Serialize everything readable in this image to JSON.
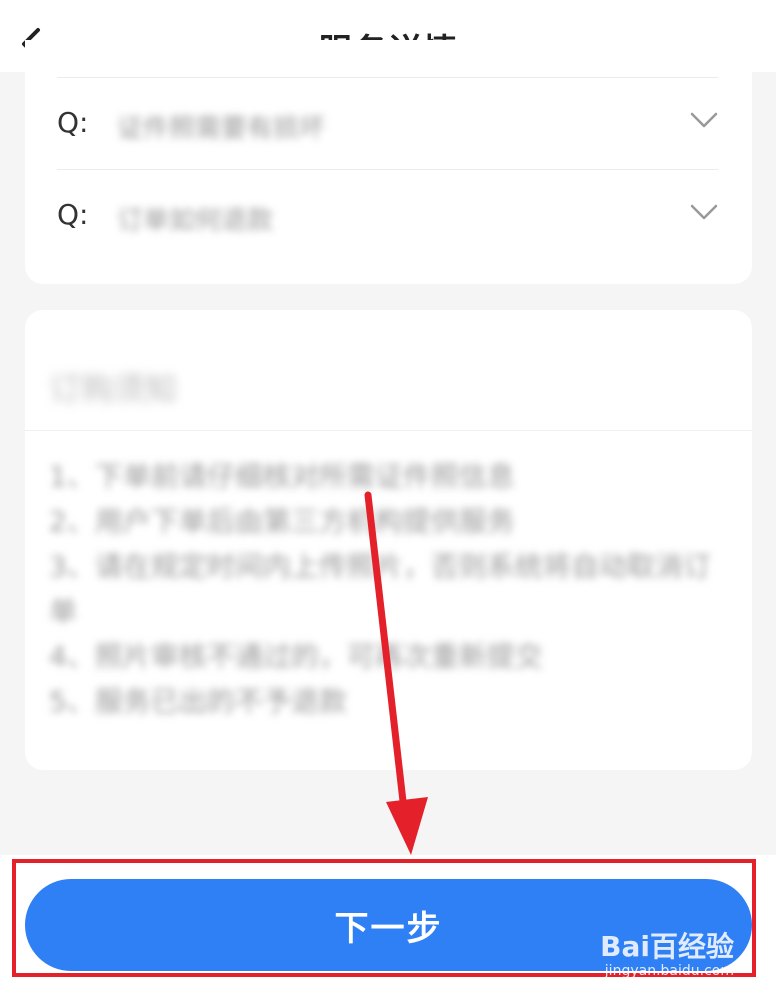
{
  "header": {
    "title": "服务详情"
  },
  "faq": [
    {
      "prefix": "Q:",
      "text": "证件照需要有损坏"
    },
    {
      "prefix": "Q:",
      "text": "订单如何退款"
    }
  ],
  "notice": {
    "title": "订购须知",
    "items": [
      "1、下单前请仔细核对所需证件照信息",
      "2、用户下单后由第三方机构提供服务",
      "3、请在规定时间内上传照片，否则系统将自动取消订单",
      "4、照片审核不通过的，可再次重新提交",
      "5、服务已出的不予退款"
    ]
  },
  "footer": {
    "next_label": "下一步"
  },
  "watermark": {
    "logo": "Bai百经验",
    "url": "jingyan.baidu.com"
  },
  "colors": {
    "accent": "#2f7ff5",
    "annotation": "#e4212b"
  }
}
